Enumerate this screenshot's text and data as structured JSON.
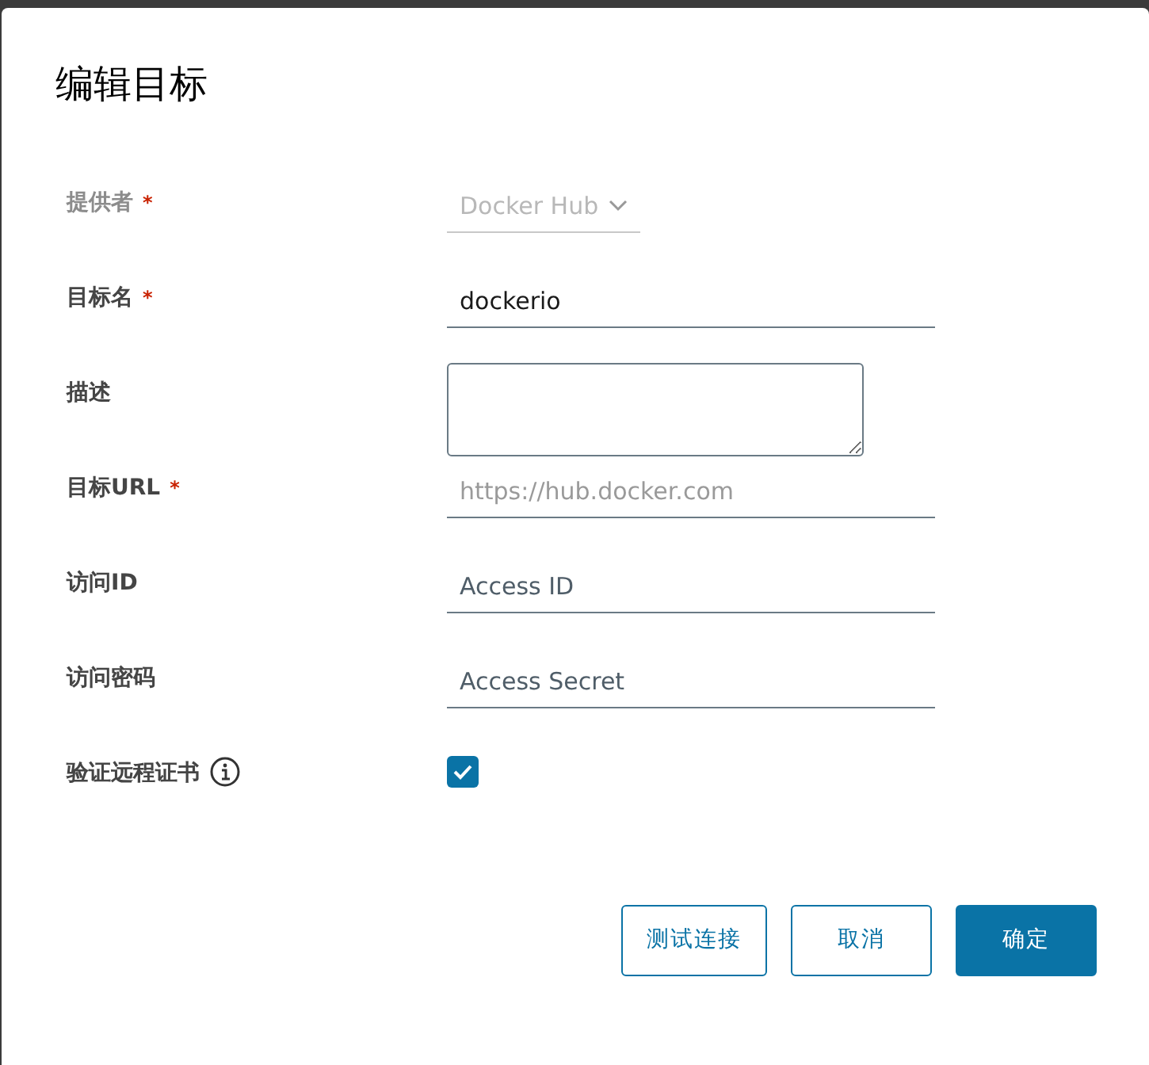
{
  "dialog": {
    "title": "编辑目标"
  },
  "fields": [
    {
      "kind": "select",
      "label": "提供者",
      "required_mark": "*",
      "disabled": true,
      "value": "Docker Hub"
    },
    {
      "kind": "text",
      "label": "目标名",
      "required_mark": "*",
      "value": "dockerio"
    },
    {
      "kind": "textarea",
      "label": "描述"
    },
    {
      "kind": "text",
      "label": "目标URL",
      "required_mark": "*",
      "placeholder": "https://hub.docker.com"
    },
    {
      "kind": "text",
      "label": "访问ID",
      "value": "Access ID"
    },
    {
      "kind": "text",
      "label": "访问密码",
      "value": "Access Secret"
    },
    {
      "kind": "checkbox",
      "label": "验证远程证书",
      "info": true,
      "checked": true
    }
  ],
  "buttons": [
    {
      "label": "测试连接",
      "kind": "outline"
    },
    {
      "label": "取消",
      "kind": "outline"
    },
    {
      "label": "确定",
      "kind": "primary"
    }
  ]
}
